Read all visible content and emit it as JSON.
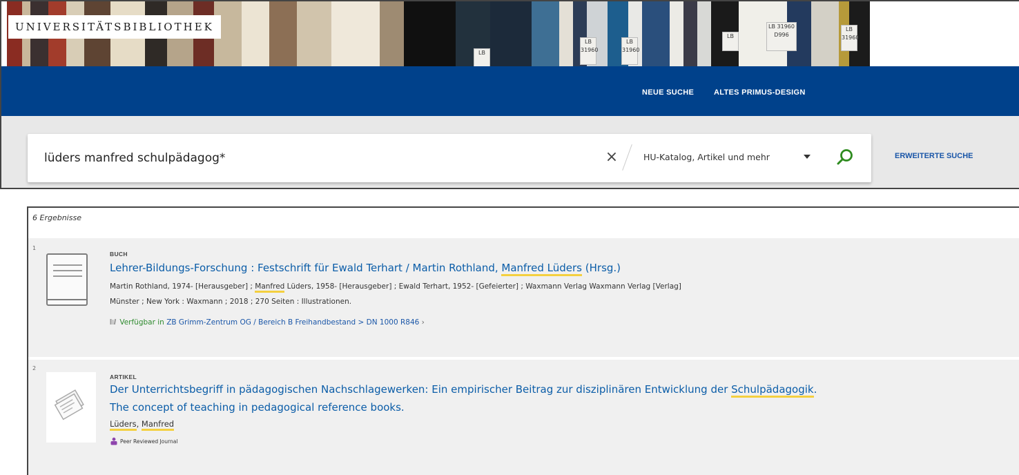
{
  "header": {
    "logo_text": "UNIVERSITÄTSBIBLIOTHEK",
    "book_labels": [
      "LB",
      "LB 31960",
      "LB 31960",
      "LB 31960 D996",
      "LB",
      "LB 31960"
    ]
  },
  "nav": {
    "new_search": "NEUE SUCHE",
    "old_design": "ALTES PRIMUS-DESIGN"
  },
  "search": {
    "query": "lüders manfred schulpädagog*",
    "scope": "HU-Katalog, Artikel und mehr",
    "advanced": "ERWEITERTE SUCHE",
    "clear_glyph": "×"
  },
  "results": {
    "count_text": "6 Ergebnisse",
    "items": [
      {
        "number": "1",
        "type": "BUCH",
        "title_parts": [
          "Lehrer-Bildungs-Forschung : Festschrift für Ewald Terhart / Martin Rothland, ",
          "Manfred Lüders",
          " (Hrsg.)"
        ],
        "creator_parts": [
          "Martin Rothland, 1974- [Herausgeber] ; ",
          "Manfred",
          " Lüders, 1958- [Herausgeber] ; Ewald Terhart, 1952- [Gefeierter] ; Waxmann Verlag Waxmann Verlag [Verlag]"
        ],
        "publication": "Münster ; New York : Waxmann ; 2018 ; 270 Seiten : Illustrationen.",
        "availability_status": "Verfügbar in",
        "availability_location": "ZB Grimm-Zentrum  OG / Bereich B Freihandbestand > DN 1000 R846",
        "availability_arrow": "›"
      },
      {
        "number": "2",
        "type": "ARTIKEL",
        "title_line1_parts": [
          "Der Unterrichtsbegriff in pädagogischen Nachschlagewerken: Ein empirischer Beitrag zur disziplinären Entwicklung der ",
          "Schulpädagogik",
          "."
        ],
        "title_line2": "The concept of teaching in pedagogical reference books.",
        "author_parts": [
          "Lüders",
          ", ",
          "Manfred"
        ],
        "badge": "Peer Reviewed Journal"
      }
    ]
  },
  "colors": {
    "nav_blue": "#00418b",
    "link_blue": "#0b5da8",
    "highlight": "#f4d03f",
    "available_green": "#2f8a2f",
    "badge_purple": "#8e44ad"
  }
}
